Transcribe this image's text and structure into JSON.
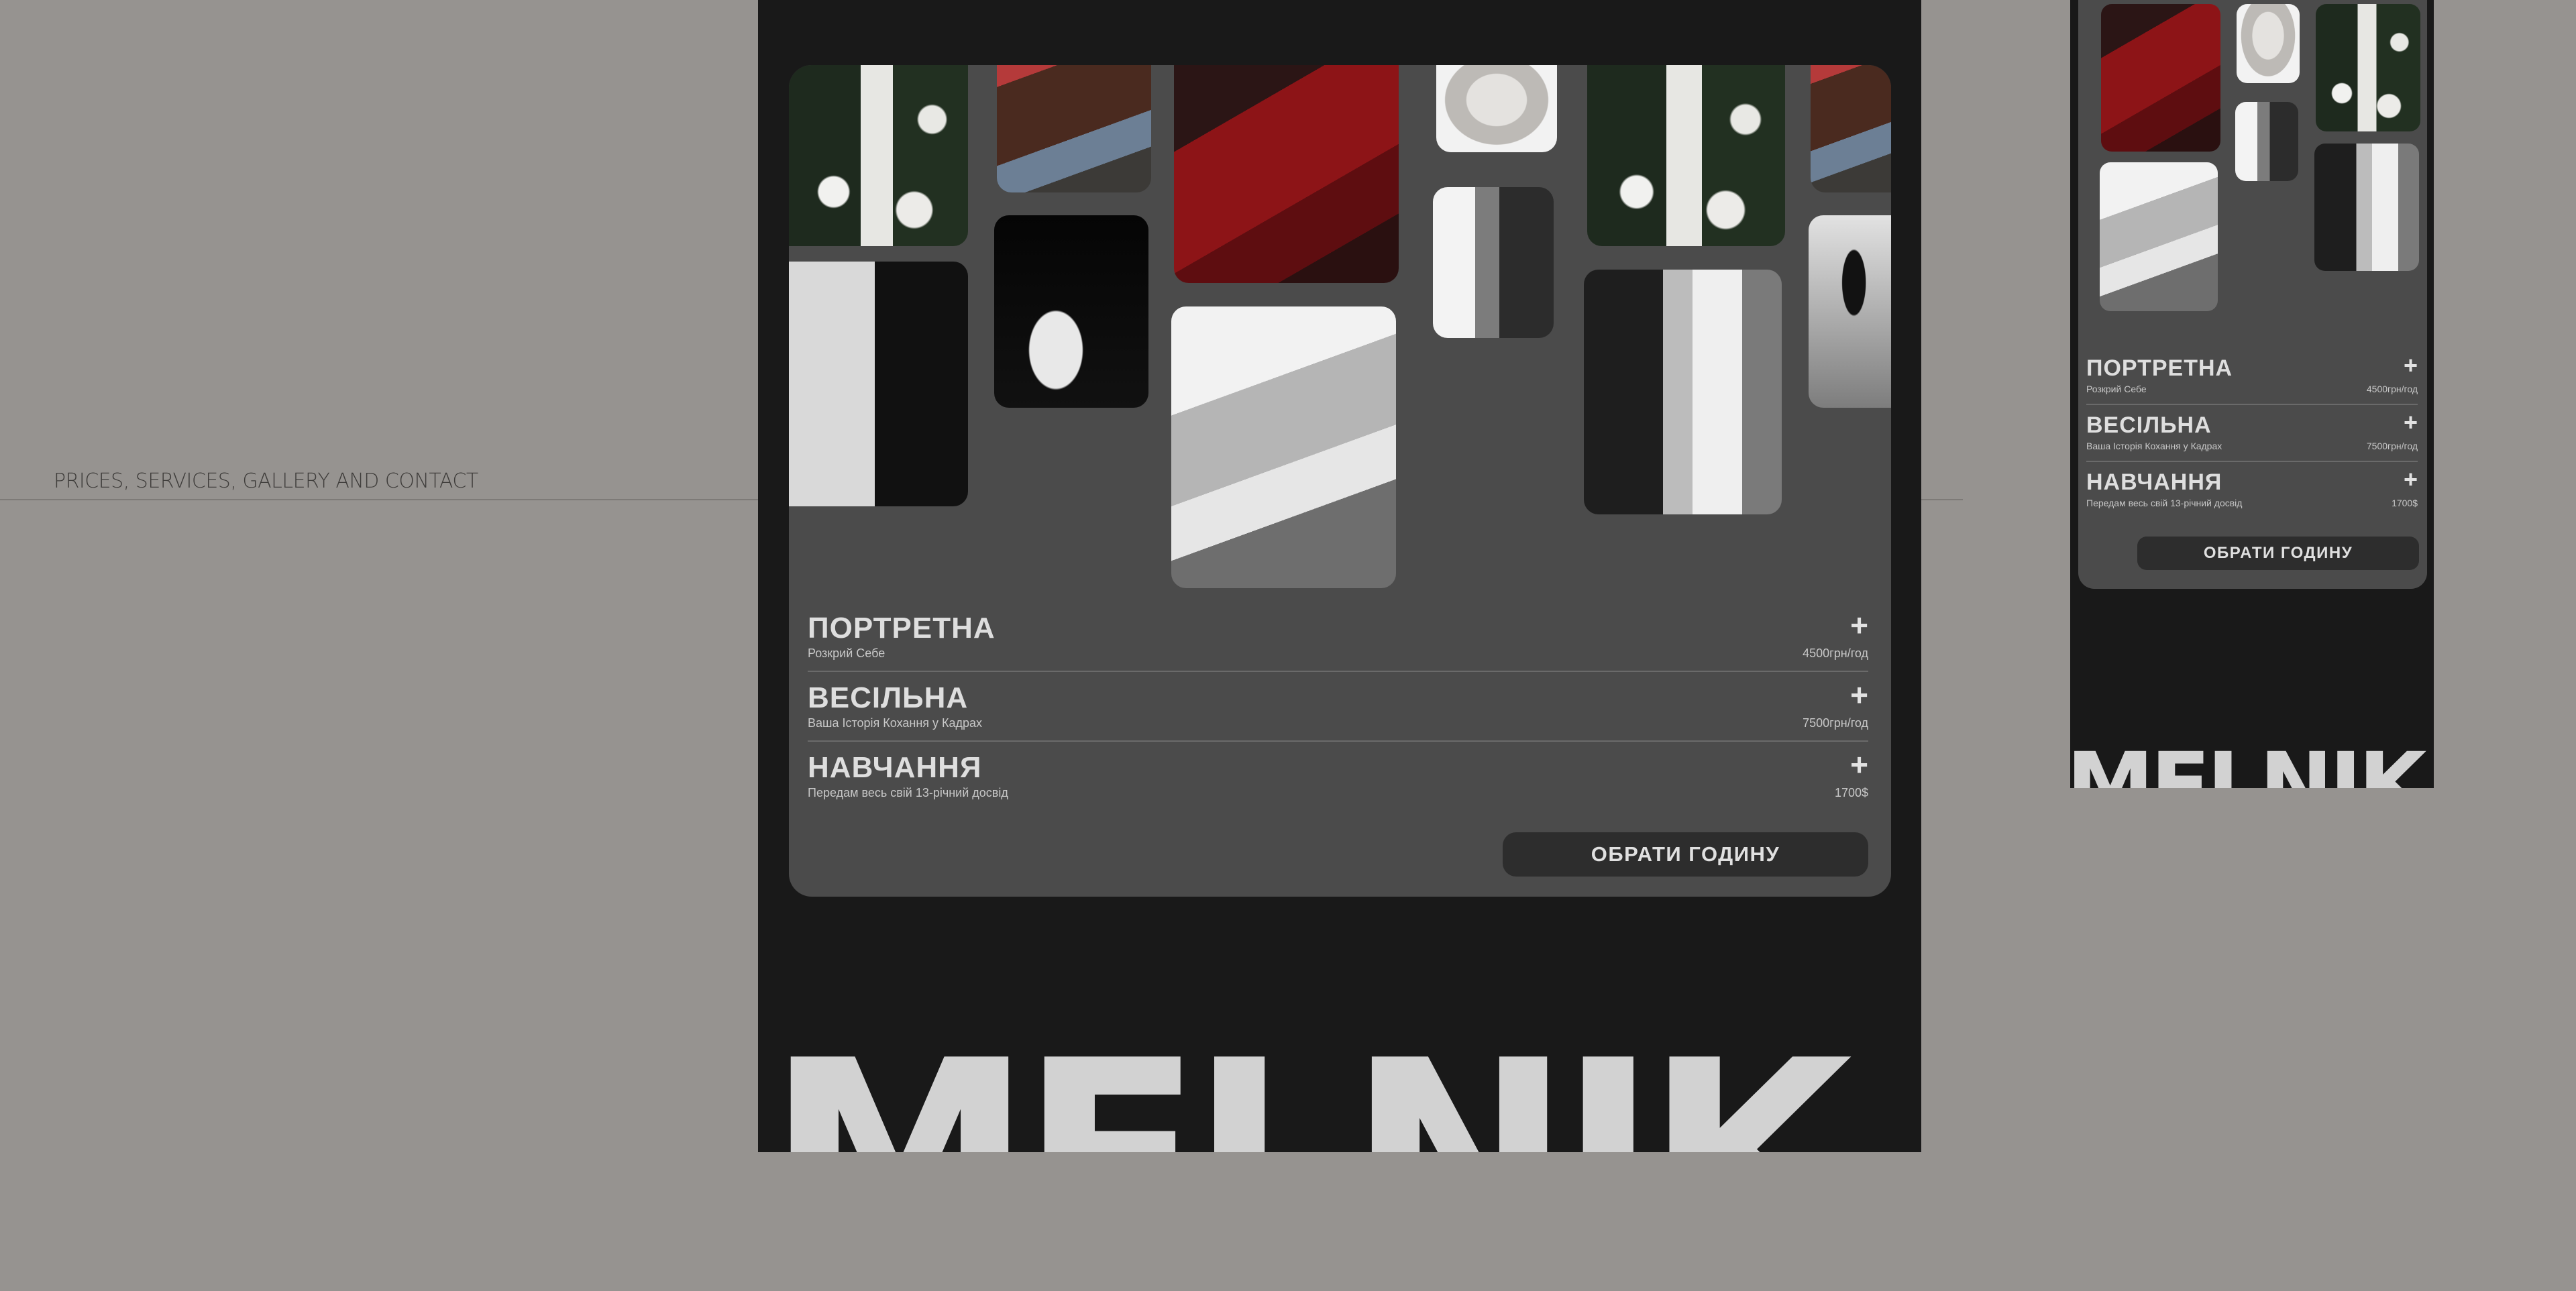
{
  "caption": "PRICES, SERVICES, GALLERY AND CONTACT",
  "brand": "MELNIK",
  "services": [
    {
      "name": "ПОРТРЕТНА",
      "desc": "Розкрий Себе",
      "price": "4500грн/год",
      "icon": "plus-icon"
    },
    {
      "name": "ВЕСІЛЬНА",
      "desc": "Ваша Історія Кохання у Кадрах",
      "price": "7500грн/год",
      "icon": "plus-icon"
    },
    {
      "name": "НАВЧАННЯ",
      "desc": "Передам весь свій 13-річний досвід",
      "price": "1700$",
      "icon": "plus-icon"
    }
  ],
  "book_button": "ОБРАТИ ГОДИНУ",
  "colors": {
    "page_bg": "#969390",
    "frame_bg": "#191919",
    "card_bg": "#4b4b4b",
    "button_bg": "#2d2d2d",
    "brand_text": "#d2d2d2"
  }
}
